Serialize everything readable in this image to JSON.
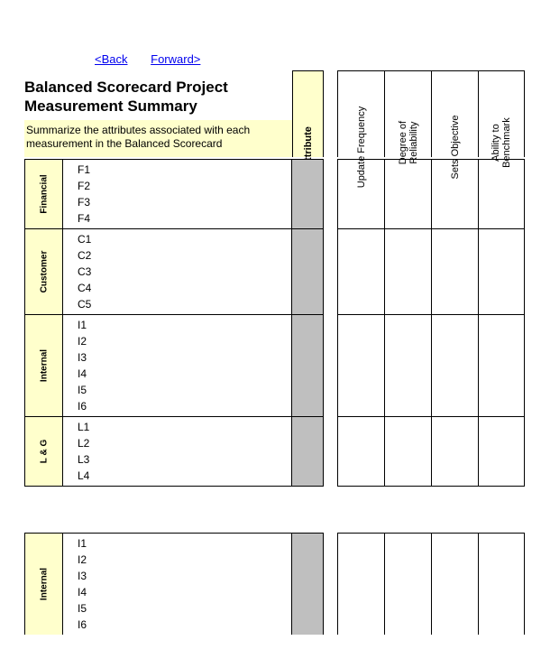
{
  "nav": {
    "back": "<Back",
    "forward": "Forward>"
  },
  "title": "Balanced Scorecard Project Measurement Summary",
  "subtitle": "Summarize the attributes associated with each measurement in the Balanced Scorecard",
  "columns": {
    "attribute": "Attribute",
    "update_frequency": "Update Frequency",
    "degree_reliability_1": "Degree of",
    "degree_reliability_2": "Reliability",
    "sets_objective": "Sets Objective",
    "ability_benchmark_1": "Ability to",
    "ability_benchmark_2": "Benchmark"
  },
  "groups": [
    {
      "label": "Financial",
      "items": [
        "F1",
        "F2",
        "F3",
        "F4"
      ]
    },
    {
      "label": "Customer",
      "items": [
        "C1",
        "C2",
        "C3",
        "C4",
        "C5"
      ]
    },
    {
      "label": "Internal",
      "items": [
        "I1",
        "I2",
        "I3",
        "I4",
        "I5",
        "I6"
      ]
    },
    {
      "label": "L & G",
      "items": [
        "L1",
        "L2",
        "L3",
        "L4"
      ]
    }
  ],
  "groups2": [
    {
      "label": "Internal",
      "items": [
        "I1",
        "I2",
        "I3",
        "I4",
        "I5",
        "I6"
      ]
    }
  ]
}
